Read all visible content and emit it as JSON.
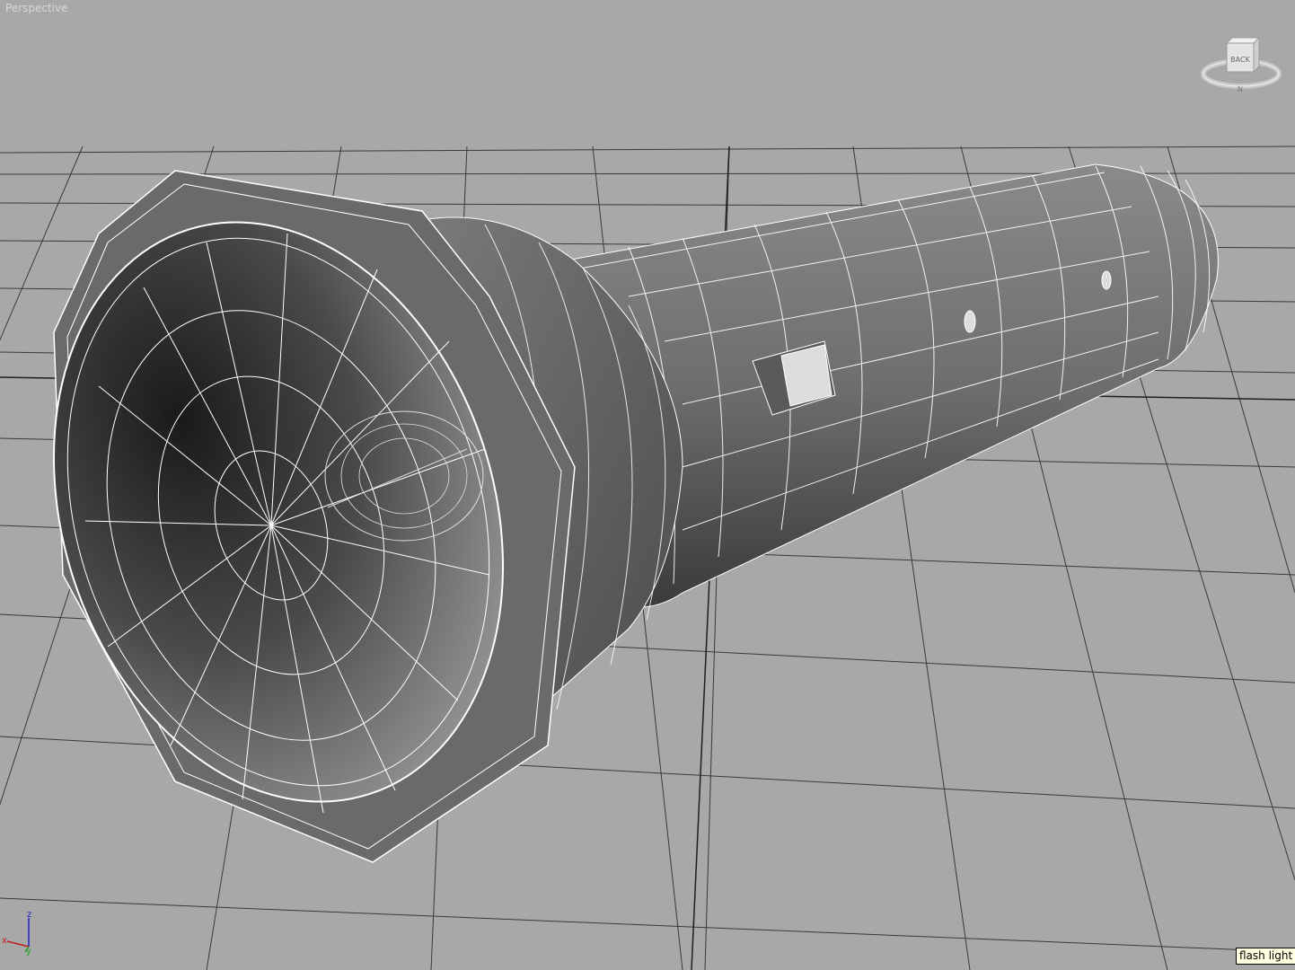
{
  "viewport": {
    "label": "Perspective",
    "background_color": "#a8a8a8",
    "grid_color": "#3a3a3a",
    "wire_color": "#ffffff"
  },
  "viewcube": {
    "face_label": "BACK",
    "compass_label": "N"
  },
  "axis_tripod": {
    "x_label": "x",
    "y_label": "y",
    "z_label": "z"
  },
  "tooltip": {
    "text": "flash light"
  },
  "model": {
    "name_icon": "flashlight-model"
  }
}
